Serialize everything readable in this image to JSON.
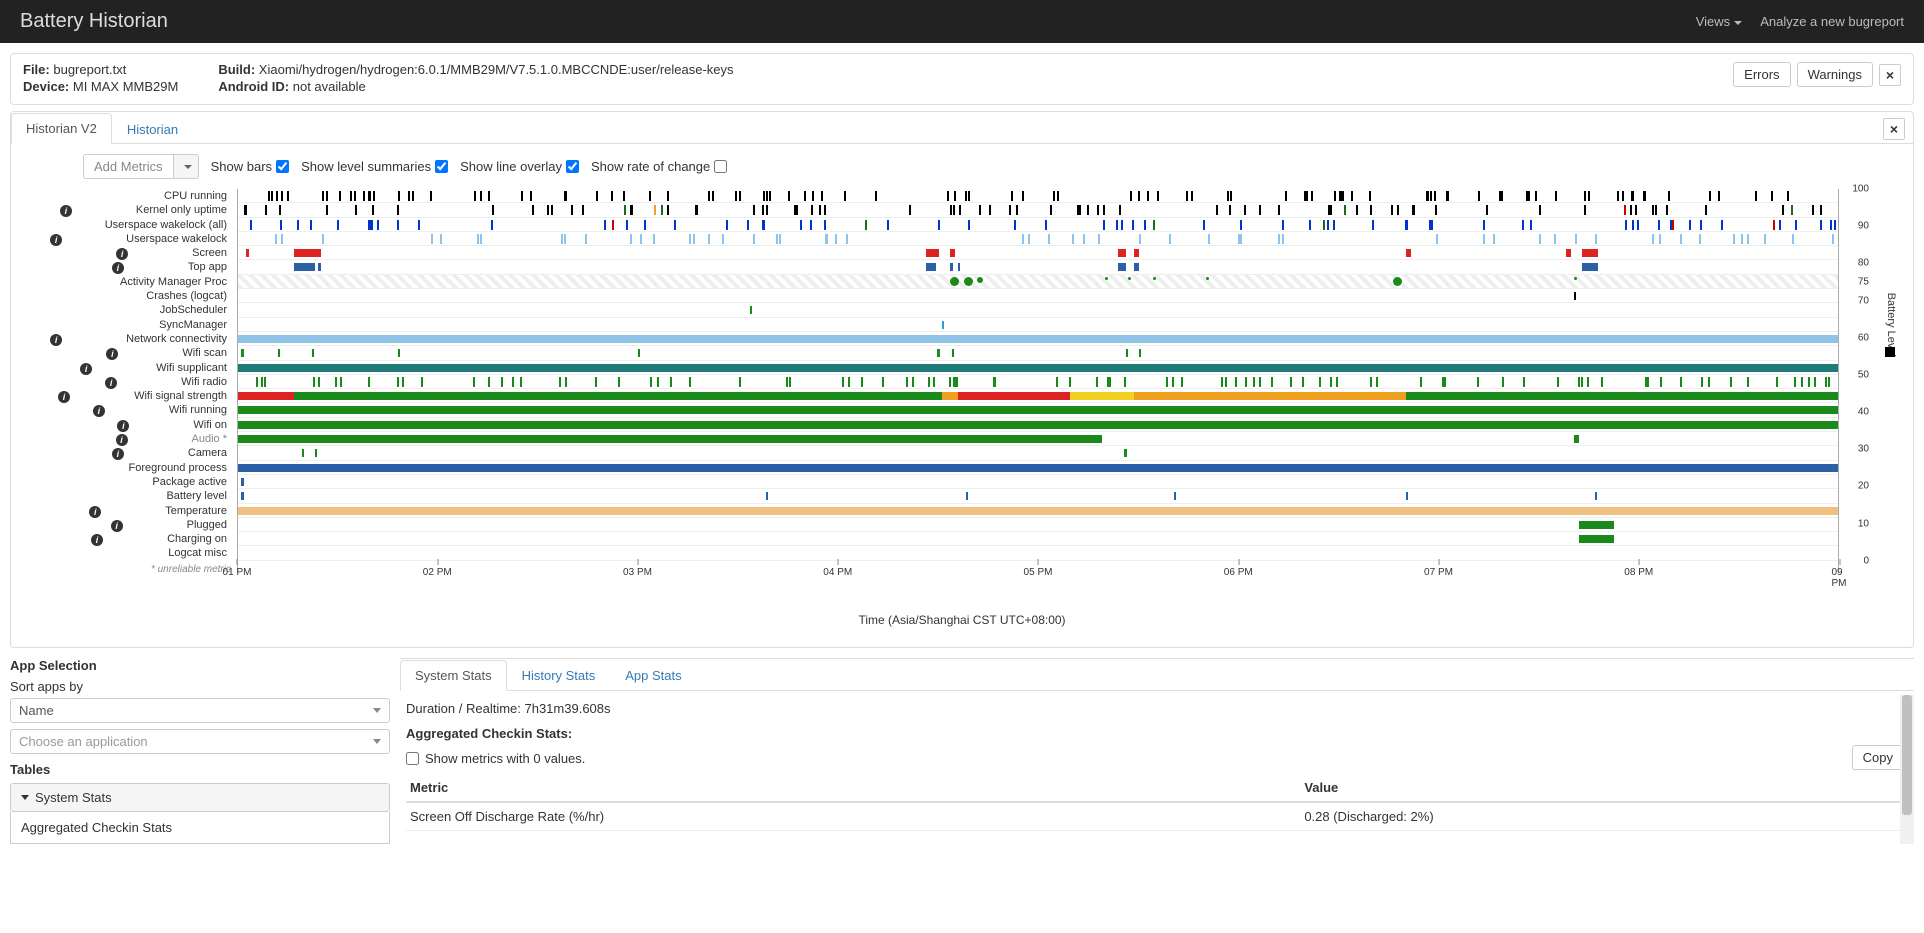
{
  "navbar": {
    "brand": "Battery Historian",
    "views": "Views",
    "analyze": "Analyze a new bugreport"
  },
  "info": {
    "file_label": "File:",
    "file_value": "bugreport.txt",
    "device_label": "Device:",
    "device_value": "MI MAX MMB29M",
    "build_label": "Build:",
    "build_value": "Xiaomi/hydrogen/hydrogen:6.0.1/MMB29M/V7.5.1.0.MBCCNDE:user/release-keys",
    "androidid_label": "Android ID:",
    "androidid_value": "not available",
    "errors": "Errors",
    "warnings": "Warnings"
  },
  "main_tabs": {
    "t1": "Historian V2",
    "t2": "Historian"
  },
  "toolbar": {
    "add_metrics": "Add Metrics",
    "show_bars": "Show bars",
    "show_level": "Show level summaries",
    "show_line": "Show line overlay",
    "show_rate": "Show rate of change"
  },
  "chart_data": {
    "type": "timeline",
    "x_label": "Time (Asia/Shanghai CST UTC+08:00)",
    "x_ticks": [
      "01 PM",
      "02 PM",
      "03 PM",
      "04 PM",
      "05 PM",
      "06 PM",
      "07 PM",
      "08 PM",
      "09 PM"
    ],
    "y_axis_label": "Battery Level",
    "y_ticks": [
      0,
      10,
      20,
      30,
      40,
      50,
      60,
      70,
      75,
      80,
      90,
      100
    ],
    "unreliable_note": "* unreliable metric",
    "rows": [
      {
        "label": "CPU running",
        "info": false,
        "bars": [
          {
            "type": "ticks",
            "color": "#000",
            "density": 0.7
          }
        ]
      },
      {
        "label": "Kernel only uptime",
        "info": true,
        "bars": [
          {
            "type": "ticks",
            "color": "#000",
            "density": 0.55,
            "extras": [
              "#cc0000",
              "#1a6b1a",
              "#f0a020"
            ]
          }
        ]
      },
      {
        "label": "Userspace wakelock (all)",
        "info": false,
        "bars": [
          {
            "type": "ticks",
            "color": "#0033cc",
            "density": 0.5,
            "extras": [
              "#cc0000",
              "#f0a020",
              "#1a6b1a"
            ]
          }
        ]
      },
      {
        "label": "Userspace wakelock",
        "info": true,
        "bars": [
          {
            "type": "ticks",
            "color": "#8fc3e8",
            "density": 0.4
          }
        ]
      },
      {
        "label": "Screen",
        "info": true,
        "bars": [
          {
            "type": "sparse",
            "color": "#d22",
            "segs": [
              [
                0.5,
                0.7
              ],
              [
                3.5,
                5.2
              ],
              [
                43,
                43.8
              ],
              [
                44.5,
                44.8
              ],
              [
                55,
                55.5
              ],
              [
                56,
                56.3
              ],
              [
                73,
                73.3
              ],
              [
                83,
                83.3
              ],
              [
                84,
                85
              ]
            ]
          }
        ]
      },
      {
        "label": "Top app",
        "info": true,
        "bars": [
          {
            "type": "sparse",
            "color": "#2b5fa6",
            "segs": [
              [
                3.5,
                4.8
              ],
              [
                5,
                5.2
              ],
              [
                43,
                43.6
              ],
              [
                44.5,
                44.7
              ],
              [
                45,
                45.1
              ],
              [
                55,
                55.5
              ],
              [
                56,
                56.3
              ],
              [
                84,
                85
              ]
            ]
          }
        ]
      },
      {
        "label": "Activity Manager Proc",
        "info": false,
        "bars": [
          {
            "type": "hatched"
          },
          {
            "type": "dots",
            "color": "#1a8a1a",
            "items": [
              [
                44.5,
                9
              ],
              [
                45.4,
                9
              ],
              [
                46.2,
                6
              ],
              [
                54.2,
                3
              ],
              [
                55.6,
                3
              ],
              [
                57.2,
                3
              ],
              [
                60.5,
                3
              ],
              [
                72.2,
                9
              ],
              [
                83.5,
                3
              ]
            ]
          }
        ]
      },
      {
        "label": "Crashes (logcat)",
        "info": false,
        "bars": [
          {
            "type": "sparse",
            "color": "#000",
            "segs": [
              [
                83.5,
                83.6
              ]
            ]
          }
        ]
      },
      {
        "label": "JobScheduler",
        "info": false,
        "bars": [
          {
            "type": "sparse",
            "color": "#1a8a1a",
            "segs": [
              [
                32,
                32.1
              ]
            ]
          }
        ]
      },
      {
        "label": "SyncManager",
        "info": false,
        "bars": [
          {
            "type": "sparse",
            "color": "#2b9fd6",
            "segs": [
              [
                44,
                44.1
              ]
            ]
          }
        ]
      },
      {
        "label": "Network connectivity",
        "info": true,
        "bars": [
          {
            "type": "solid",
            "color": "#8fc3e8",
            "segs": [
              [
                0,
                100
              ]
            ]
          }
        ]
      },
      {
        "label": "Wifi scan",
        "info": true,
        "bars": [
          {
            "type": "sparse",
            "color": "#1a8a1a",
            "segs": [
              [
                0.2,
                0.3
              ],
              [
                2.5,
                2.6
              ],
              [
                4.6,
                4.7
              ],
              [
                10,
                10.1
              ],
              [
                25,
                25.1
              ],
              [
                43.7,
                43.8
              ],
              [
                44.6,
                44.7
              ],
              [
                55.5,
                55.6
              ],
              [
                56.3,
                56.4
              ]
            ]
          }
        ]
      },
      {
        "label": "Wifi supplicant",
        "info": true,
        "bars": [
          {
            "type": "solid",
            "color": "#1f7a7a",
            "segs": [
              [
                0,
                100
              ]
            ]
          }
        ]
      },
      {
        "label": "Wifi radio",
        "info": true,
        "bars": [
          {
            "type": "ticks",
            "color": "#1a8a1a",
            "density": 0.65
          }
        ]
      },
      {
        "label": "Wifi signal strength",
        "info": true,
        "bars": [
          {
            "type": "multi",
            "segs": [
              [
                "#d22",
                0,
                3.5
              ],
              [
                "#1a8a1a",
                3.5,
                44
              ],
              [
                "#f0a020",
                44,
                45
              ],
              [
                "#d22",
                45,
                52
              ],
              [
                "#f0d020",
                52,
                56
              ],
              [
                "#f0a020",
                56,
                73
              ],
              [
                "#1a8a1a",
                73,
                100
              ]
            ]
          }
        ]
      },
      {
        "label": "Wifi running",
        "info": true,
        "bars": [
          {
            "type": "solid",
            "color": "#1a8a1a",
            "segs": [
              [
                0,
                100
              ]
            ]
          }
        ]
      },
      {
        "label": "Wifi on",
        "info": true,
        "bars": [
          {
            "type": "solid",
            "color": "#1a8a1a",
            "segs": [
              [
                0,
                100
              ]
            ]
          }
        ]
      },
      {
        "label": "Audio *",
        "info": true,
        "css": "audio-label",
        "bars": [
          {
            "type": "solid",
            "color": "#1a8a1a",
            "segs": [
              [
                0,
                54
              ]
            ]
          },
          {
            "type": "sparse",
            "color": "#1a8a1a",
            "segs": [
              [
                83.5,
                83.8
              ]
            ]
          }
        ]
      },
      {
        "label": "Camera",
        "info": true,
        "bars": [
          {
            "type": "sparse",
            "color": "#1a8a1a",
            "segs": [
              [
                4,
                4.1
              ],
              [
                4.8,
                4.9
              ],
              [
                55.4,
                55.5
              ]
            ]
          }
        ]
      },
      {
        "label": "Foreground process",
        "info": false,
        "bars": [
          {
            "type": "solid",
            "color": "#2b5fa6",
            "segs": [
              [
                0,
                100
              ]
            ]
          }
        ]
      },
      {
        "label": "Package active",
        "info": false,
        "bars": [
          {
            "type": "sparse",
            "color": "#2b5fa6",
            "segs": [
              [
                0.2,
                0.3
              ]
            ]
          }
        ]
      },
      {
        "label": "Battery level",
        "info": false,
        "bars": [
          {
            "type": "sparse",
            "color": "#2b5fa6",
            "segs": [
              [
                0.2,
                0.3
              ],
              [
                33,
                33.1
              ],
              [
                45.5,
                45.6
              ],
              [
                58.5,
                58.6
              ],
              [
                73,
                73.1
              ],
              [
                84.8,
                84.9
              ]
            ]
          }
        ]
      },
      {
        "label": "Temperature",
        "info": true,
        "bars": [
          {
            "type": "solid",
            "color": "#f0c080",
            "segs": [
              [
                0,
                100
              ]
            ]
          }
        ]
      },
      {
        "label": "Plugged",
        "info": true,
        "bars": [
          {
            "type": "solid",
            "color": "#1a8a1a",
            "segs": [
              [
                83.8,
                86
              ]
            ]
          }
        ]
      },
      {
        "label": "Charging on",
        "info": true,
        "bars": [
          {
            "type": "solid",
            "color": "#1a8a1a",
            "segs": [
              [
                83.8,
                86
              ]
            ]
          }
        ]
      },
      {
        "label": "Logcat misc",
        "info": false,
        "bars": []
      }
    ]
  },
  "left": {
    "app_selection": "App Selection",
    "sort_by": "Sort apps by",
    "sort_value": "Name",
    "choose_placeholder": "Choose an application",
    "tables": "Tables",
    "system_stats": "System Stats",
    "agg_checkin": "Aggregated Checkin Stats"
  },
  "right": {
    "tabs": {
      "t1": "System Stats",
      "t2": "History Stats",
      "t3": "App Stats"
    },
    "duration": "Duration / Realtime: 7h31m39.608s",
    "agg_title": "Aggregated Checkin Stats:",
    "show_zero": "Show metrics with 0 values.",
    "copy": "Copy",
    "table": {
      "h1": "Metric",
      "h2": "Value",
      "r1c1": "Screen Off Discharge Rate (%/hr)",
      "r1c2": "0.28 (Discharged: 2%)"
    }
  }
}
